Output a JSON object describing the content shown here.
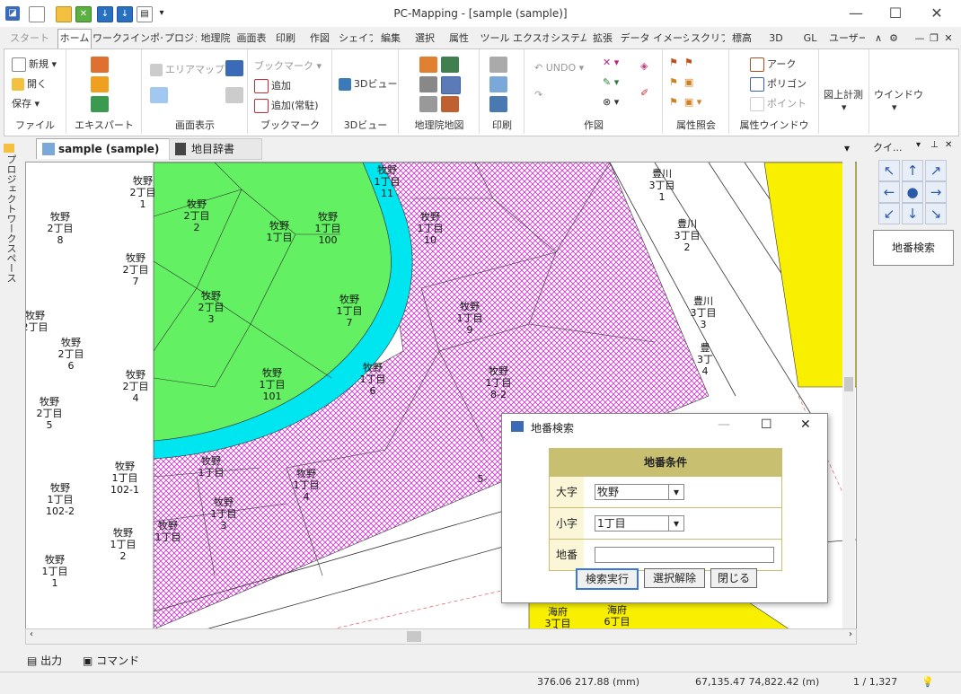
{
  "window": {
    "title": "PC-Mapping - [sample (sample)]"
  },
  "tabs": [
    "スタート",
    "ホーム",
    "ワークス",
    "インポー",
    "プロジェ",
    "地理院",
    "画面表",
    "印刷",
    "作図",
    "シェイプ",
    "編集",
    "選択",
    "属性",
    "ツール",
    "エクスポ",
    "システム",
    "拡張",
    "データ",
    "イメージ",
    "スクリプ",
    "標高",
    "3D",
    "GL",
    "ユーザー"
  ],
  "ribbon": {
    "file": {
      "label": "ファイル",
      "new": "新規",
      "open": "開く",
      "save": "保存"
    },
    "expert": {
      "label": "エキスパート"
    },
    "display": {
      "label": "画面表示",
      "areamap": "エリアマップ"
    },
    "bookmark": {
      "label": "ブックマーク",
      "bookmark_dd": "ブックマーク",
      "add": "追加",
      "add_resident": "追加(常駐)"
    },
    "view3d": {
      "label": "3Dビュー",
      "btn": "3Dビュー"
    },
    "gsi": {
      "label": "地理院地図"
    },
    "print": {
      "label": "印刷"
    },
    "draw": {
      "label": "作図",
      "undo": "UNDO"
    },
    "attr": {
      "label": "属性照会"
    },
    "attrwin": {
      "label": "属性ウインドウ",
      "arc": "アーク",
      "polygon": "ポリゴン",
      "point": "ポイント"
    },
    "measure": {
      "label": "図上計測"
    },
    "window": {
      "label": "ウインドウ"
    }
  },
  "left_panel": {
    "label": "プロジェクトワークスペース"
  },
  "doc_tabs": {
    "sample": "sample (sample)",
    "dict": "地目辞書"
  },
  "right_panel": {
    "title": "クイ...",
    "search_btn": "地番検索"
  },
  "output_tabs": {
    "output": "出力",
    "command": "コマンド"
  },
  "status": {
    "coords_mm": "376.06 217.88 (mm)",
    "coords_m": "67,135.47 74,822.42 (m)",
    "page": "1 / 1,327"
  },
  "dialog": {
    "title": "地番検索",
    "header": "地番条件",
    "oaza_label": "大字",
    "oaza_value": "牧野",
    "koaza_label": "小字",
    "koaza_value": "1丁目",
    "chiban_label": "地番",
    "chiban_value": "",
    "search_btn": "検索実行",
    "clear_btn": "選択解除",
    "close_btn": "閉じる"
  },
  "map": {
    "colors": {
      "green": "#63f062",
      "cyan": "#00e6f0",
      "magenta": "#e040e0",
      "yellow": "#f8f000"
    },
    "labels": [
      {
        "t1": "牧野",
        "t2": "2丁目",
        "t3": "1"
      },
      {
        "t1": "牧野",
        "t2": "2丁目",
        "t3": "2"
      },
      {
        "t1": "牧野",
        "t2": "2丁目",
        "t3": "3"
      },
      {
        "t1": "牧野",
        "t2": "2丁目",
        "t3": "4"
      },
      {
        "t1": "牧野",
        "t2": "2丁目",
        "t3": "5"
      },
      {
        "t1": "牧野",
        "t2": "2丁目",
        "t3": "6"
      },
      {
        "t1": "牧野",
        "t2": "2丁目",
        "t3": "7"
      },
      {
        "t1": "牧野",
        "t2": "2丁目",
        "t3": "8"
      },
      {
        "t1": "牧野",
        "t2": "2丁目",
        "t3": ""
      },
      {
        "t1": "牧野",
        "t2": "1丁目",
        "t3": ""
      },
      {
        "t1": "牧野",
        "t2": "1丁目",
        "t3": "100"
      },
      {
        "t1": "牧野",
        "t2": "1丁目",
        "t3": "10"
      },
      {
        "t1": "牧野",
        "t2": "1丁目",
        "t3": "11"
      },
      {
        "t1": "牧野",
        "t2": "1丁目",
        "t3": "7"
      },
      {
        "t1": "牧野",
        "t2": "1丁目",
        "t3": "9"
      },
      {
        "t1": "牧野",
        "t2": "1丁目",
        "t3": "101"
      },
      {
        "t1": "牧野",
        "t2": "1丁目",
        "t3": "6"
      },
      {
        "t1": "牧野",
        "t2": "1丁目",
        "t3": "8-2"
      },
      {
        "t1": "牧野",
        "t2": "1丁目",
        "t3": ""
      },
      {
        "t1": "牧野",
        "t2": "1丁目",
        "t3": "102-1"
      },
      {
        "t1": "牧野",
        "t2": "1丁目",
        "t3": "102-2"
      },
      {
        "t1": "牧野",
        "t2": "1丁目",
        "t3": "4"
      },
      {
        "t1": "牧野",
        "t2": "1丁目",
        "t3": "3"
      },
      {
        "t1": "牧野",
        "t2": "1丁目",
        "t3": "2"
      },
      {
        "t1": "牧野",
        "t2": "1丁目",
        "t3": ""
      },
      {
        "t1": "牧野",
        "t2": "1丁目",
        "t3": "1"
      },
      {
        "t1": "",
        "t2": "",
        "t3": "5-"
      },
      {
        "t1": "豊川",
        "t2": "3丁目",
        "t3": "1"
      },
      {
        "t1": "豊川",
        "t2": "3丁目",
        "t3": "2"
      },
      {
        "t1": "豊川",
        "t2": "3丁目",
        "t3": "3"
      },
      {
        "t1": "豊",
        "t2": "3丁",
        "t3": "4"
      },
      {
        "t1": "海府",
        "t2": "6丁目",
        "t3": "5-1"
      },
      {
        "t1": "海府",
        "t2": "3丁目",
        "t3": ""
      },
      {
        "t1": "",
        "t2": "",
        "t3": "4"
      }
    ]
  }
}
